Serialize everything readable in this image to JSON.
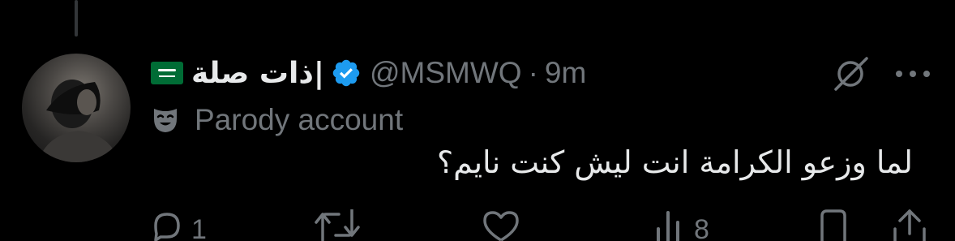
{
  "tweet": {
    "display_name": "ذات صلة|",
    "handle": "@MSMWQ",
    "separator": "·",
    "time": "9m",
    "label_text": "Parody account",
    "text": "لما وزعو الكرامة انت ليش كنت نايم؟"
  },
  "actions": {
    "reply_count": "1",
    "repost_count": "",
    "like_count": "",
    "views_count": "8"
  },
  "icons": {
    "flag": "saudi-arabia-flag-emoji",
    "verified": "verified-badge-icon",
    "grok": "grok-icon",
    "more": "more-icon",
    "label": "theater-mask-icon",
    "reply": "reply-icon",
    "repost": "repost-icon",
    "like": "heart-icon",
    "views": "views-icon",
    "bookmark": "bookmark-icon",
    "share": "share-icon"
  },
  "colors": {
    "background": "#000000",
    "primary_text": "#e7e9ea",
    "secondary_text": "#71767b",
    "verified_blue": "#1d9bf0",
    "flag_green": "#006c35"
  }
}
